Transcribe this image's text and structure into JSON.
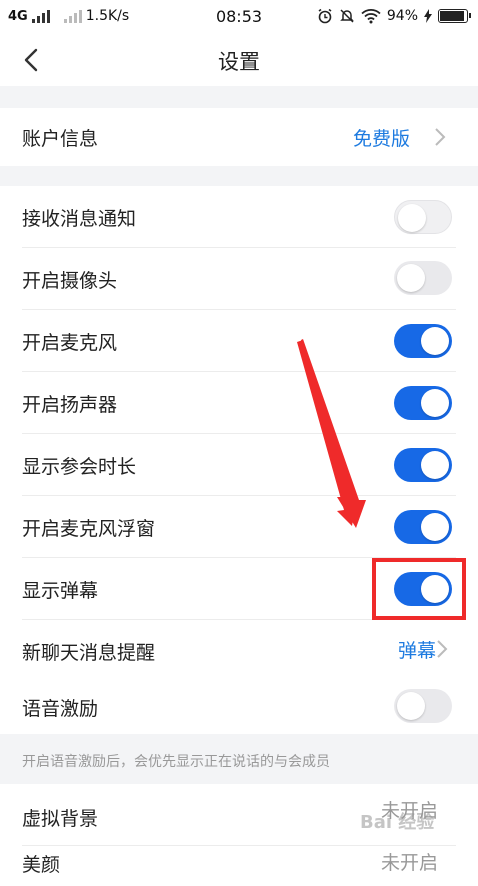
{
  "status_bar": {
    "network": "4G",
    "speed": "1.5K/s",
    "time": "08:53",
    "battery": "94%",
    "battery_level": 0.94
  },
  "header": {
    "title": "设置"
  },
  "account": {
    "label": "账户信息",
    "value": "免费版"
  },
  "toggles": [
    {
      "label": "接收消息通知",
      "on": false
    },
    {
      "label": "开启摄像头",
      "on": false
    },
    {
      "label": "开启麦克风",
      "on": true
    },
    {
      "label": "开启扬声器",
      "on": true
    },
    {
      "label": "显示参会时长",
      "on": true
    },
    {
      "label": "开启麦克风浮窗",
      "on": true
    },
    {
      "label": "显示弹幕",
      "on": true
    }
  ],
  "new_chat": {
    "label": "新聊天消息提醒",
    "value": "弹幕"
  },
  "voice": {
    "label": "语音激励",
    "on": false
  },
  "voice_hint": "开启语音激励后，会优先显示正在说话的与会成员",
  "virtual_bg": {
    "label": "虚拟背景",
    "value": "未开启"
  },
  "beauty": {
    "label": "美颜",
    "value": "未开启"
  },
  "watermark": "Bai 经验",
  "colors": {
    "accent": "#1769e6",
    "highlight": "#ef2a2a",
    "link": "#1e7be0"
  }
}
